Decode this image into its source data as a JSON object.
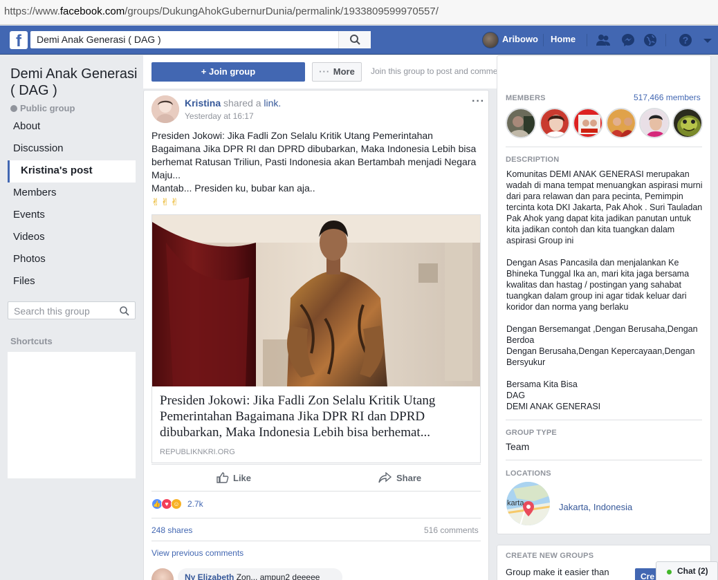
{
  "browser": {
    "url_prefix": "https://www.",
    "url_domain": "facebook.com",
    "url_path": "/groups/DukungAhokGubernurDunia/permalink/1933809599970557/"
  },
  "topbar": {
    "search_value": "Demi Anak Generasi ( DAG )",
    "user_name": "Aribowo",
    "home_label": "Home",
    "brand_color": "#4267b2"
  },
  "sidebar": {
    "group_name": "Demi Anak Generasi ( DAG )",
    "privacy": "Public group",
    "items": [
      {
        "label": "About"
      },
      {
        "label": "Discussion"
      },
      {
        "label": "Kristina's post",
        "active": true
      },
      {
        "label": "Members"
      },
      {
        "label": "Events"
      },
      {
        "label": "Videos"
      },
      {
        "label": "Photos"
      },
      {
        "label": "Files"
      }
    ],
    "search_placeholder": "Search this group",
    "shortcuts_label": "Shortcuts"
  },
  "actions": {
    "join_label": "Join group",
    "more_label": "More",
    "join_hint": "Join this group to post and comment."
  },
  "post": {
    "author": "Kristina",
    "shared_text": " shared a ",
    "link_word": "link.",
    "time": "Yesterday at 16:17",
    "body": "Presiden Jokowi: Jika Fadli Zon Selalu Kritik Utang Pemerintahan Bagaimana Jika DPR RI dan DPRD dibubarkan, Maka Indonesia Lebih bisa berhemat Ratusan Triliun, Pasti Indonesia akan Bertambah menjadi Negara Maju...",
    "body2": "Mantab... Presiden ku, bubar kan aja..",
    "emoji": "✌✌✌",
    "link_title": "Presiden Jokowi: Jika Fadli Zon Selalu Kritik Utang Pemerintahan Bagaimana Jika DPR RI dan DPRD dibubarkan, Maka Indonesia Lebih bisa berhemat...",
    "link_domain": "REPUBLIKNKRI.ORG",
    "like_label": "Like",
    "share_label": "Share",
    "reaction_count": "2.7k",
    "shares": "248 shares",
    "comments": "516 comments",
    "view_previous": "View previous comments",
    "comment_author": "Ny Elizabeth",
    "comment_text": " Zon... ampun2 deeeee"
  },
  "right": {
    "members_label": "MEMBERS",
    "members_count": "517,466 members",
    "description_label": "DESCRIPTION",
    "description": "Komunitas DEMI ANAK GENERASI merupakan wadah di mana tempat menuangkan aspirasi murni dari para relawan dan para pecinta, Pemimpin tercinta kota DKI Jakarta, Pak Ahok . Suri Tauladan Pak Ahok yang dapat kita jadikan panutan untuk kita jadikan contoh dan kita tuangkan dalam aspirasi Group ini\n\nDengan Asas Pancasila dan menjalankan Ke Bhineka Tunggal Ika an, mari kita jaga bersama kwalitas dan hastag / postingan yang sahabat tuangkan dalam group ini agar tidak keluar dari koridor dan norma yang berlaku\n\nDengan Bersemangat ,Dengan Berusaha,Dengan Berdoa\nDengan Berusaha,Dengan Kepercayaan,Dengan Bersyukur\n\nBersama Kita Bisa\nDAG\nDEMI ANAK GENERASI",
    "group_type_label": "GROUP TYPE",
    "group_type": "Team",
    "locations_label": "LOCATIONS",
    "map_text": "karta",
    "location": "Jakarta, Indonesia",
    "create_label": "CREATE NEW GROUPS",
    "create_text": "Group make it easier than",
    "create_btn": "Cre"
  },
  "chat": {
    "label": "Chat (2)"
  }
}
